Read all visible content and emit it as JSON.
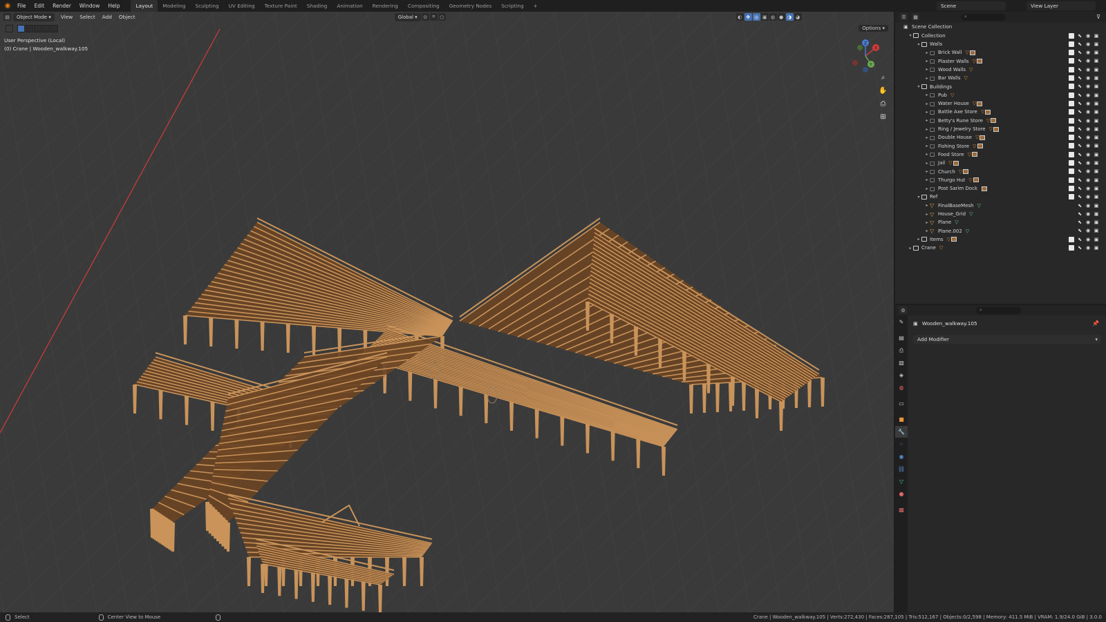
{
  "menu": [
    "File",
    "Edit",
    "Render",
    "Window",
    "Help"
  ],
  "workspaces": [
    "Layout",
    "Modeling",
    "Sculpting",
    "UV Editing",
    "Texture Paint",
    "Shading",
    "Animation",
    "Rendering",
    "Compositing",
    "Geometry Nodes",
    "Scripting",
    "+"
  ],
  "active_workspace": "Layout",
  "scene_name": "Scene",
  "view_layer": "View Layer",
  "viewport": {
    "mode": "Object Mode",
    "menus": [
      "View",
      "Select",
      "Add",
      "Object"
    ],
    "transform": "Global",
    "perspective": "User Perspective (Local)",
    "context": "(0) Crane | Wooden_walkway.105",
    "options": "Options",
    "gizmo_axes": [
      "X",
      "Y",
      "Z"
    ]
  },
  "outliner": {
    "root": "Scene Collection",
    "rows": [
      {
        "name": "Collection",
        "level": 1,
        "type": "collection",
        "expanded": true,
        "extra": ""
      },
      {
        "name": "Walls",
        "level": 2,
        "type": "collection",
        "expanded": true,
        "extra": ""
      },
      {
        "name": "Brick Wall",
        "level": 3,
        "type": "object",
        "extra": "mesh-mat"
      },
      {
        "name": "Plaster Walls",
        "level": 3,
        "type": "object",
        "extra": "mesh-mat"
      },
      {
        "name": "Wood Walls",
        "level": 3,
        "type": "object",
        "extra": "mesh"
      },
      {
        "name": "Bar Walls",
        "level": 3,
        "type": "object",
        "extra": "mesh"
      },
      {
        "name": "Buildings",
        "level": 2,
        "type": "collection",
        "expanded": true,
        "extra": ""
      },
      {
        "name": "Pub",
        "level": 3,
        "type": "object",
        "extra": "mesh"
      },
      {
        "name": "Water House",
        "level": 3,
        "type": "object",
        "extra": "mesh-mat"
      },
      {
        "name": "Battle Axe Store",
        "level": 3,
        "type": "object",
        "extra": "mesh-mat"
      },
      {
        "name": "Betty's Rune Store",
        "level": 3,
        "type": "object",
        "extra": "mesh-mat"
      },
      {
        "name": "Ring / Jewelry Store",
        "level": 3,
        "type": "object",
        "extra": "mesh-mat"
      },
      {
        "name": "Double House",
        "level": 3,
        "type": "object",
        "extra": "mesh-mat"
      },
      {
        "name": "Fishing Store",
        "level": 3,
        "type": "object",
        "extra": "mesh-mat"
      },
      {
        "name": "Food Store",
        "level": 3,
        "type": "object",
        "extra": "mesh-mat"
      },
      {
        "name": "Jail",
        "level": 3,
        "type": "object",
        "extra": "mesh-mat"
      },
      {
        "name": "Church",
        "level": 3,
        "type": "object",
        "extra": "mesh-mat"
      },
      {
        "name": "Thurgo Hut",
        "level": 3,
        "type": "object",
        "extra": "mesh-mat"
      },
      {
        "name": "Post Sarim Dock",
        "level": 3,
        "type": "object",
        "extra": "mat"
      },
      {
        "name": "Ref",
        "level": 2,
        "type": "collection",
        "expanded": true,
        "extra": ""
      },
      {
        "name": "FinalBaseMesh",
        "level": 3,
        "type": "mesh",
        "extra": "green"
      },
      {
        "name": "House_Grid",
        "level": 3,
        "type": "mesh",
        "extra": "green"
      },
      {
        "name": "Plane",
        "level": 3,
        "type": "mesh",
        "extra": "green"
      },
      {
        "name": "Plane.002",
        "level": 3,
        "type": "mesh",
        "extra": "green"
      },
      {
        "name": "Items",
        "level": 2,
        "type": "collection",
        "expanded": false,
        "extra": "mesh-mat"
      },
      {
        "name": "Crane",
        "level": 1,
        "type": "collection",
        "expanded": false,
        "extra": "mesh"
      }
    ]
  },
  "properties": {
    "object_name": "Wooden_walkway.105",
    "add_modifier": "Add Modifier"
  },
  "status": {
    "left_action": "Select",
    "middle_action": "Center View to Mouse",
    "stats": "Crane | Wooden_walkway.105 | Verts:272,430 | Faces:287,105 | Tris:512,167 | Objects:0/2,598 | Memory: 411.5 MiB | VRAM: 1.9/24.0 GiB | 3.0.0"
  },
  "colors": {
    "viewport_bg": "#3a3a3a",
    "grid_line": "#454545",
    "wood_light": "#c9935a",
    "wood_dark": "#6b4523",
    "x_axis": "#d33b3b",
    "accent_blue": "#4772b3",
    "orange": "#e87d0d"
  }
}
